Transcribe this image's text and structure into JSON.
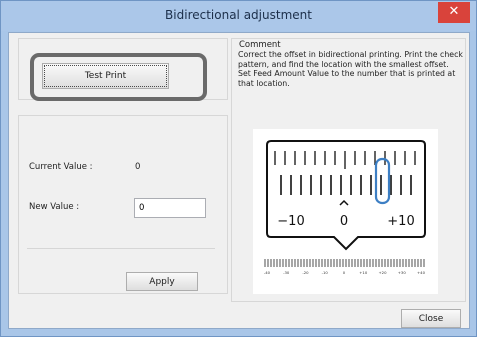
{
  "window": {
    "title": "Bidirectional adjustment",
    "close_glyph": "✕"
  },
  "left": {
    "test_print_label": "Test Print",
    "current_value_label": "Current Value :",
    "current_value": "0",
    "new_value_label": "New Value :",
    "new_value": "0",
    "apply_label": "Apply"
  },
  "comment": {
    "title": "Comment",
    "text": "Correct the offset in bidirectional printing. Print the check pattern, and find the location with the smallest offset. Set Feed Amount Value to the number that is printed at that location."
  },
  "diagram": {
    "label_left": "−10",
    "label_center": "0",
    "label_right": "+10",
    "small_labels": [
      "-40",
      "-30",
      "-20",
      "-10",
      "0",
      "+10",
      "+20",
      "+30",
      "+40"
    ]
  },
  "footer": {
    "close_label": "Close"
  },
  "colors": {
    "title_bar": "#abc7e9",
    "close_red": "#d9433b",
    "highlight_blue": "#3d7fc4",
    "outline_gray": "#6a6a6a"
  }
}
